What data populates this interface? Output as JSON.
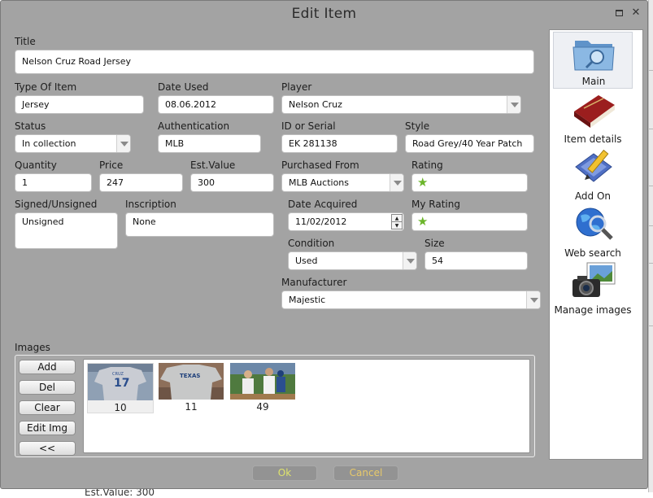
{
  "window": {
    "title": "Edit Item",
    "maximize_icon": "maximize-icon",
    "close_icon": "close-icon",
    "close_glyph": "✕"
  },
  "form": {
    "title": {
      "label": "Title",
      "value": "Nelson Cruz Road Jersey"
    },
    "type_of_item": {
      "label": "Type Of Item",
      "value": "Jersey"
    },
    "date_used": {
      "label": "Date Used",
      "value": "08.06.2012"
    },
    "player": {
      "label": "Player",
      "value": "Nelson Cruz"
    },
    "status": {
      "label": "Status",
      "value": "In collection"
    },
    "authentication": {
      "label": "Authentication",
      "value": "MLB"
    },
    "id_or_serial": {
      "label": "ID or Serial",
      "value": "EK 281138"
    },
    "style": {
      "label": "Style",
      "value": "Road Grey/40 Year Patch"
    },
    "quantity": {
      "label": "Quantity",
      "value": "1"
    },
    "price": {
      "label": "Price",
      "value": "247"
    },
    "est_value": {
      "label": "Est.Value",
      "value": "300"
    },
    "purchased_from": {
      "label": "Purchased From",
      "value": "MLB Auctions"
    },
    "rating": {
      "label": "Rating",
      "stars": 1,
      "star_glyph": "★",
      "star_color": "#6bb52a"
    },
    "signed_unsigned": {
      "label": "Signed/Unsigned",
      "value": "Unsigned"
    },
    "inscription": {
      "label": "Inscription",
      "value": "None"
    },
    "date_acquired": {
      "label": "Date Acquired",
      "value": "11/02/2012",
      "spin_up": "▲",
      "spin_down": "▼"
    },
    "my_rating": {
      "label": "My Rating",
      "stars": 1,
      "star_glyph": "★",
      "star_color": "#6bb52a"
    },
    "condition": {
      "label": "Condition",
      "value": "Used"
    },
    "size": {
      "label": "Size",
      "value": "54"
    },
    "manufacturer": {
      "label": "Manufacturer",
      "value": "Majestic"
    }
  },
  "images": {
    "label": "Images",
    "buttons": [
      "Add",
      "Del",
      "Clear",
      "Edit Img",
      "<<"
    ],
    "thumbnails": [
      {
        "caption": "10",
        "selected": true
      },
      {
        "caption": "11",
        "selected": false
      },
      {
        "caption": "49",
        "selected": false
      }
    ]
  },
  "sidebar": {
    "items": [
      {
        "label": "Main",
        "icon": "folder-search-icon",
        "active": true
      },
      {
        "label": "Item details",
        "icon": "notebook-icon",
        "active": false
      },
      {
        "label": "Add On",
        "icon": "pencil-add-icon",
        "active": false
      },
      {
        "label": "Web search",
        "icon": "globe-search-icon",
        "active": false
      },
      {
        "label": "Manage images",
        "icon": "camera-icon",
        "active": false
      }
    ]
  },
  "actions": {
    "ok": "Ok",
    "cancel": "Cancel"
  },
  "background": {
    "underlying_text": "Est.Value: 300"
  },
  "colors": {
    "dialog_bg": "#a3a3a3",
    "ok_text": "#dfe46d",
    "cancel_text": "#e8c96a"
  }
}
